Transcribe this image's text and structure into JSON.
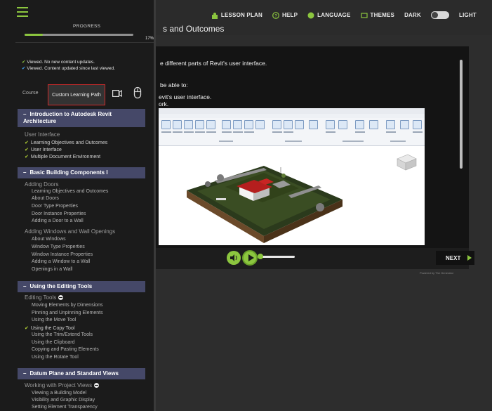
{
  "header": {
    "page_title": "s and Outcomes",
    "links": [
      {
        "label": "LESSON PLAN",
        "icon": "lesson-plan-icon"
      },
      {
        "label": "HELP",
        "icon": "help-icon"
      },
      {
        "label": "LANGUAGE",
        "icon": "language-icon"
      },
      {
        "label": "THEMES",
        "icon": "themes-icon"
      }
    ],
    "theme_dark": "DARK",
    "theme_light": "LIGHT"
  },
  "sidebar": {
    "progress_label": "PROGRESS",
    "progress_percent": "17%",
    "progress_value": 0.17,
    "legend": [
      "Viewed. No new content updates.",
      "Viewed. Content updated since last viewed."
    ],
    "modes": {
      "course": "Course",
      "custom": "Custom Learning Path"
    },
    "sections": [
      {
        "title": "Introduction to Autodesk Revit Architecture"
      },
      {
        "title": "Basic Building Components I"
      },
      {
        "title": "Using the Editing Tools"
      },
      {
        "title": "Datum Plane and Standard Views"
      }
    ],
    "subsections": [
      "User Interface",
      "Adding Doors",
      "Adding Windows and Wall Openings",
      "Editing Tools",
      "Working with Project Views"
    ],
    "items": [
      "Learning Objectives and Outcomes",
      "User Interface",
      "Multiple Document Environment",
      "Learning Objectives and Outcomes",
      "About Doors",
      "Door Type Properties",
      "Door Instance Properties",
      "Adding a Door to a Wall",
      "About Windows",
      "Window Type Properties",
      "Window Instance Properties",
      "Adding a Window to a Wall",
      "Openings in a Wall",
      "Moving Elements by Dimensions",
      "Pinning and Unpinning Elements",
      "Using the Move Tool",
      "Using the Copy Tool",
      "Using the Trim/Extend Tools",
      "Using the Clipboard",
      "Copying and Pasting Elements",
      "Using the Rotate Tool",
      "Viewing a Building Model",
      "Visibility and Graphic Display",
      "Setting Element Transparency"
    ]
  },
  "content": {
    "line1": "e different parts of Revit's user interface.",
    "line2": "be able to:",
    "line3": "evit's user interface.",
    "line4": "ork."
  },
  "player": {
    "next_label": "NEXT",
    "powered_by": "Powered by The Generator"
  },
  "colors": {
    "accent": "#8cc63f",
    "section_bg": "#454868",
    "highlight_border": "#d02a2a"
  }
}
